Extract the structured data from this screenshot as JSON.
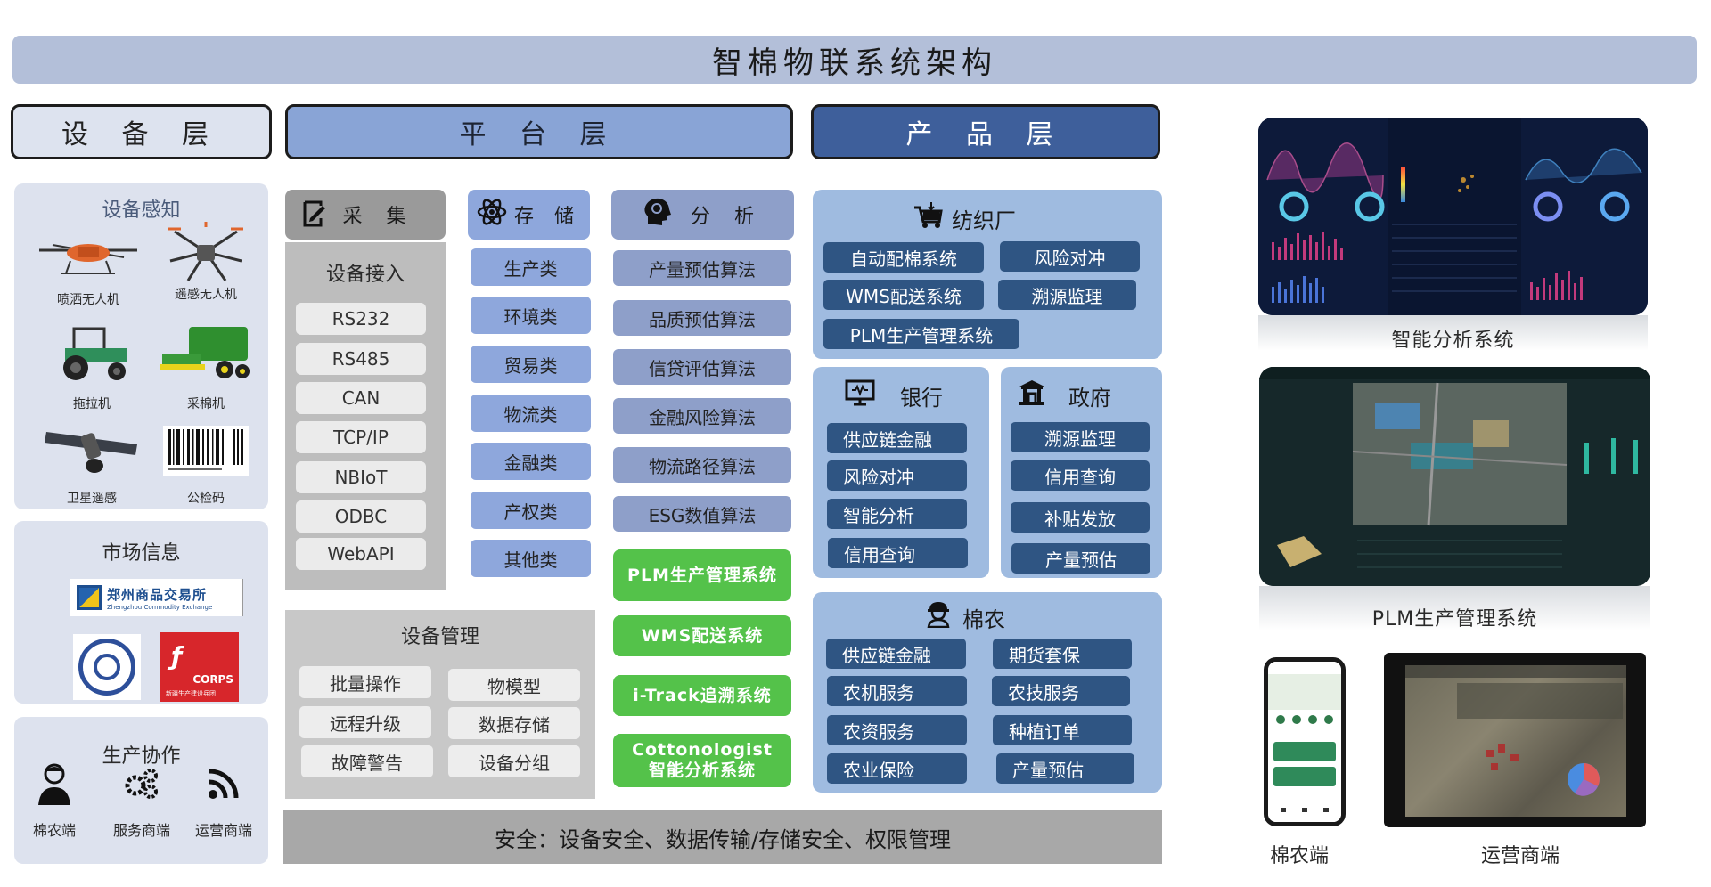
{
  "title": "智棉物联系统架构",
  "layers": {
    "device": "设 备 层",
    "platform": "平 台 层",
    "product": "产 品 层"
  },
  "device_layer": {
    "sensing": {
      "title": "设备感知",
      "devices": [
        {
          "label": "喷洒无人机",
          "icon": "spray-drone-icon"
        },
        {
          "label": "遥感无人机",
          "icon": "remote-sensing-drone-icon"
        },
        {
          "label": "拖拉机",
          "icon": "tractor-icon"
        },
        {
          "label": "采棉机",
          "icon": "cotton-picker-icon"
        },
        {
          "label": "卫星遥感",
          "icon": "satellite-icon"
        },
        {
          "label": "公检码",
          "icon": "barcode-icon"
        }
      ]
    },
    "market": {
      "title": "市场信息",
      "logos": {
        "zce_cn": "郑州商品交易所",
        "zce_en": "Zhengzhou Commodity Exchange",
        "corps_brand": "CORPS",
        "corps_sub": "新疆生产建设兵团"
      }
    },
    "collab": {
      "title": "生产协作",
      "items": [
        {
          "label": "棉农端",
          "icon": "user-icon"
        },
        {
          "label": "服务商端",
          "icon": "gears-icon"
        },
        {
          "label": "运营商端",
          "icon": "rss-icon"
        }
      ]
    }
  },
  "platform_layer": {
    "collect": {
      "header": "采 集",
      "subtitle": "设备接入",
      "protocols": [
        "RS232",
        "RS485",
        "CAN",
        "TCP/IP",
        "NBIoT",
        "ODBC",
        "WebAPI"
      ]
    },
    "storage": {
      "header": "存 储",
      "items": [
        "生产类",
        "环境类",
        "贸易类",
        "物流类",
        "金融类",
        "产权类",
        "其他类"
      ]
    },
    "analysis": {
      "header": "分 析",
      "algorithms": [
        "产量预估算法",
        "品质预估算法",
        "信贷评估算法",
        "金融风险算法",
        "物流路径算法",
        "ESG数值算法"
      ],
      "systems": [
        "PLM生产管理系统",
        "WMS配送系统",
        "i-Track追溯系统",
        "Cottonologist 智能分析系统"
      ]
    },
    "device_mgmt": {
      "title": "设备管理",
      "items": [
        "批量操作",
        "物模型",
        "远程升级",
        "数据存储",
        "故障警告",
        "设备分组"
      ]
    },
    "security": "安全：设备安全、数据传输/存储安全、权限管理"
  },
  "product_layer": {
    "textile": {
      "title": "纺织厂",
      "items": [
        "自动配棉系统",
        "风险对冲",
        "WMS配送系统",
        "溯源监理",
        "PLM生产管理系统"
      ]
    },
    "bank": {
      "title": "银行",
      "items": [
        "供应链金融",
        "风险对冲",
        "智能分析",
        "信用查询"
      ]
    },
    "government": {
      "title": "政府",
      "items": [
        "溯源监理",
        "信用查询",
        "补贴发放",
        "产量预估"
      ]
    },
    "farmer": {
      "title": "棉农",
      "items": [
        "供应链金融",
        "期货套保",
        "农机服务",
        "农技服务",
        "农资服务",
        "种植订单",
        "农业保险",
        "产量预估"
      ]
    }
  },
  "showcase": {
    "analysis_caption": "智能分析系统",
    "plm_caption": "PLM生产管理系统",
    "phone_caption": "棉农端",
    "tablet_caption": "运营商端"
  },
  "colors": {
    "title_bar": "#b3bfd9",
    "platform_header": "#89a4d6",
    "product_header": "#3e5f9b",
    "product_button": "#2f5583",
    "green_system": "#54c24a",
    "security_bar": "#a8a8a8"
  }
}
